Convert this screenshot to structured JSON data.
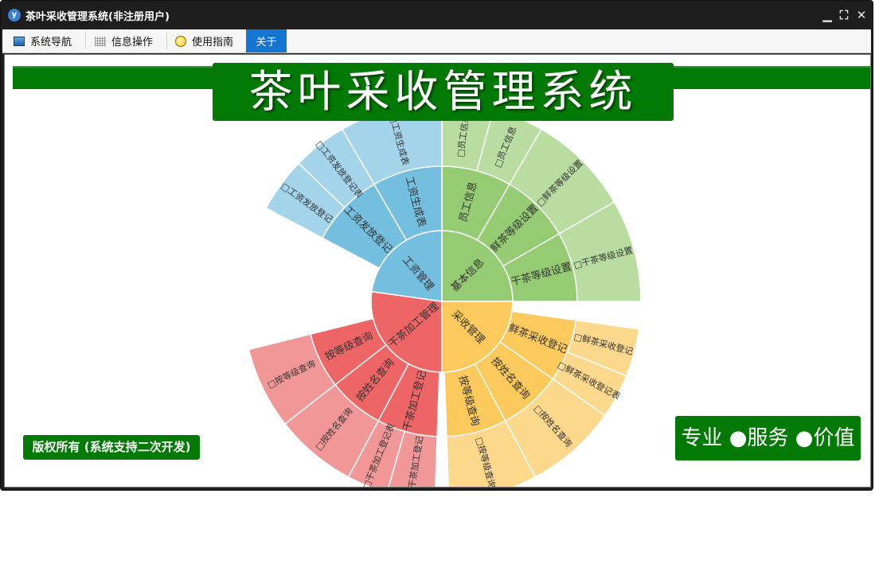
{
  "window": {
    "title": "茶叶采收管理系统(非注册用户)",
    "controls": {
      "minimize": "▁",
      "restore": "⛶",
      "close": "✕"
    }
  },
  "menu": {
    "tabs": [
      {
        "label": "系统导航",
        "icon": "monitor-icon"
      },
      {
        "label": "信息操作",
        "icon": "grid-icon"
      },
      {
        "label": "使用指南",
        "icon": "lightbulb-icon"
      },
      {
        "label": "关于",
        "icon": ""
      }
    ],
    "active_tab": "关于"
  },
  "banner": {
    "title": "茶叶采收管理系统"
  },
  "footer": {
    "copyright": "版权所有 (系统支持二次开发)",
    "slogan": "专业 ●服务 ●价值"
  },
  "colors": {
    "brand_green": "#047a06",
    "active_tab": "#1576d1",
    "segment_green": "#95cc73",
    "segment_green_light": "#b9dda0",
    "segment_orange": "#fbc95c",
    "segment_orange_light": "#fcd88c",
    "segment_red": "#ee6566",
    "segment_red_light": "#f29797",
    "segment_blue": "#74bfe0",
    "segment_blue_light": "#a3d4ea"
  },
  "sunburst": {
    "nodes": [
      {
        "label": "基本信息",
        "color": "#95cc73",
        "light": "#b9dda0",
        "children": [
          {
            "label": "员工信息",
            "children": [
              {
                "label": "□员工信息"
              },
              {
                "label": "□员工信息"
              }
            ]
          },
          {
            "label": "鲜茶等级设置",
            "children": [
              {
                "label": "□鲜茶等级设置"
              }
            ]
          },
          {
            "label": "干茶等级设置",
            "children": [
              {
                "label": "□干茶等级设置"
              }
            ]
          }
        ]
      },
      {
        "label": "采收管理",
        "color": "#fbc95c",
        "light": "#fcd88c",
        "children": [
          {
            "label": "鲜茶采收登记",
            "children": [
              {
                "label": "□鲜茶采收登记"
              },
              {
                "label": "□鲜茶采收登记表"
              }
            ]
          },
          {
            "label": "按姓名查询",
            "children": [
              {
                "label": "□按姓名查询"
              }
            ]
          },
          {
            "label": "按等级查询",
            "children": [
              {
                "label": "□按等级查询"
              }
            ]
          }
        ]
      },
      {
        "label": "干茶加工管理",
        "color": "#ee6566",
        "light": "#f29797",
        "children": [
          {
            "label": "干茶加工登记",
            "children": [
              {
                "label": "□干茶加工登记"
              },
              {
                "label": "□干茶加工登记表"
              }
            ]
          },
          {
            "label": "按姓名查询",
            "children": [
              {
                "label": "□按姓名查询"
              }
            ]
          },
          {
            "label": "按等级查询",
            "children": [
              {
                "label": "□按等级查询"
              }
            ]
          }
        ]
      },
      {
        "label": "工资管理",
        "color": "#74bfe0",
        "light": "#a3d4ea",
        "children": [
          {
            "label": "工资发放登记",
            "children": [
              {
                "label": "□工资发放登记"
              },
              {
                "label": "□工资发放登记表"
              }
            ]
          },
          {
            "label": "工资生成表",
            "children": [
              {
                "label": "□工资生成表"
              }
            ]
          }
        ]
      }
    ]
  }
}
